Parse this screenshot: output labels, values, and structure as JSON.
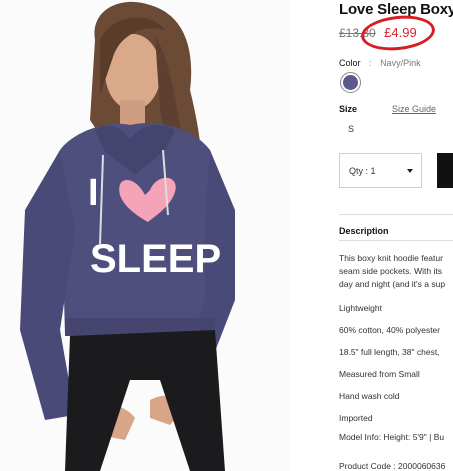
{
  "product": {
    "title": "Love Sleep Boxy",
    "price_original": "£13.80",
    "price_sale": "£4.99",
    "color_label": "Color",
    "color_separator": ":",
    "color_value": "Navy/Pink",
    "swatch_color": "#5a5a8c",
    "size_label": "Size",
    "size_guide": "Size Guide",
    "size_selected": "S",
    "quantity_text": "Qty : 1",
    "graphic_text_top": "I",
    "graphic_text_bottom": "SLEEP",
    "description": {
      "heading": "Description",
      "paragraph": [
        "This boxy knit hoodie featur",
        "seam side pockets. With its",
        "day and night (and it's a sup"
      ],
      "specs": [
        "Lightweight",
        "60% cotton, 40% polyester",
        "18.5\" full length, 38\" chest,",
        "Measured from Small",
        "Hand wash cold",
        "Imported",
        "Model Info: Height: 5'9\" | Bu",
        "Product Code : 2000060636"
      ]
    }
  },
  "colors": {
    "sale_red": "#d6262e",
    "annotation_red": "#d81c24",
    "hoodie": "#4f4f7e",
    "heart": "#f4a3b8"
  }
}
